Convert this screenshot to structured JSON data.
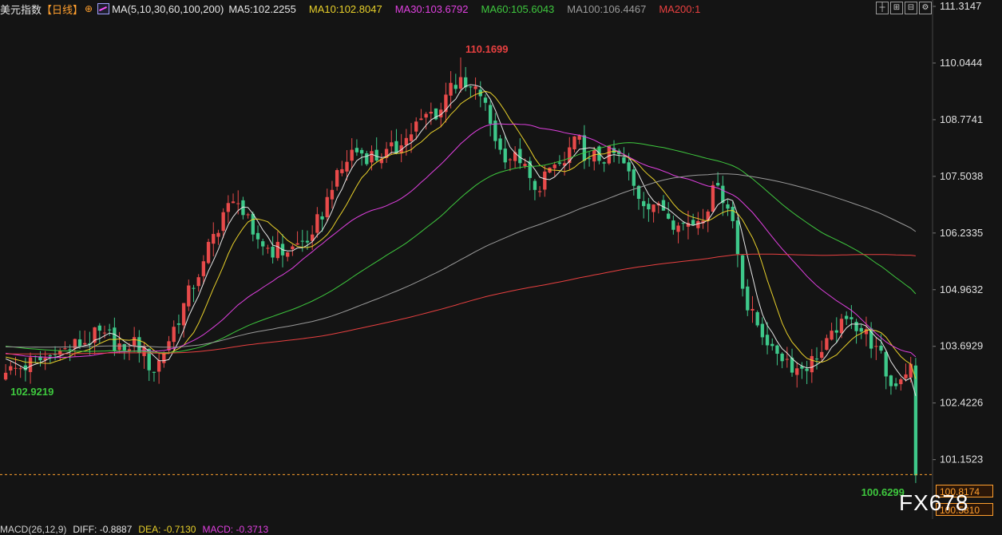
{
  "header": {
    "symbol": "美元指数",
    "period": "【日线】",
    "circle_icon": "⊕",
    "ma_icon": "ma-chart-icon",
    "ma_label": "MA(5,10,30,60,100,200)",
    "ma_values": [
      {
        "text": "MA5:102.2255",
        "color": "#e6e6e6"
      },
      {
        "text": "MA10:102.8047",
        "color": "#e8d02a"
      },
      {
        "text": "MA30:103.6792",
        "color": "#e040e0"
      },
      {
        "text": "MA60:105.6043",
        "color": "#3ec83e"
      },
      {
        "text": "MA100:106.4467",
        "color": "#9a9a9a"
      },
      {
        "text": "MA200:1",
        "color": "#e84040"
      }
    ]
  },
  "tools": [
    "crosshair-icon",
    "zoom-in-icon",
    "zoom-out-icon",
    "settings-icon"
  ],
  "watermark": "FX678",
  "macd": [
    {
      "text": "MACD(26,12,9)",
      "color": "#cfcfcf"
    },
    {
      "text": "DIFF: -0.8887",
      "color": "#e6e6e6"
    },
    {
      "text": "DEA: -0.7130",
      "color": "#e8d02a"
    },
    {
      "text": "MACD: -0.3713",
      "color": "#e040e0"
    }
  ],
  "price_tags": {
    "last": "100.8174",
    "low2": "100.5810"
  },
  "chart_data": {
    "type": "candlestick",
    "title": "美元指数【日线】",
    "ylim": [
      100.0,
      111.3147
    ],
    "y_ticks": [
      "111.3147",
      "110.0444",
      "108.7741",
      "107.5038",
      "106.2335",
      "104.9632",
      "103.6929",
      "102.4226",
      "101.1523"
    ],
    "annotations": [
      {
        "text": "110.1699",
        "candle_index": 92,
        "kind": "high",
        "color": "#e84040"
      },
      {
        "text": "102.9219",
        "candle_index": 0,
        "kind": "low",
        "color": "#3ec83e"
      },
      {
        "text": "100.6299",
        "candle_index": 184,
        "kind": "low",
        "color": "#3ec83e"
      }
    ],
    "last_price": 100.8174,
    "up_color": "#e84a4a",
    "down_color": "#3ec88a",
    "candle_count": 185,
    "anchors": [
      [
        0,
        103.1
      ],
      [
        10,
        103.5
      ],
      [
        20,
        104.0
      ],
      [
        24,
        103.6
      ],
      [
        26,
        103.9
      ],
      [
        30,
        103.1
      ],
      [
        40,
        105.6
      ],
      [
        44,
        106.7
      ],
      [
        47,
        106.9
      ],
      [
        50,
        106.2
      ],
      [
        53,
        105.9
      ],
      [
        57,
        105.8
      ],
      [
        62,
        106.2
      ],
      [
        66,
        107.2
      ],
      [
        70,
        108.1
      ],
      [
        76,
        107.9
      ],
      [
        80,
        108.2
      ],
      [
        84,
        108.8
      ],
      [
        88,
        109.0
      ],
      [
        90,
        109.6
      ],
      [
        93,
        109.5
      ],
      [
        96,
        109.3
      ],
      [
        100,
        108.1
      ],
      [
        104,
        107.8
      ],
      [
        107,
        107.2
      ],
      [
        110,
        107.7
      ],
      [
        113,
        107.8
      ],
      [
        115,
        108.4
      ],
      [
        118,
        107.9
      ],
      [
        124,
        108.0
      ],
      [
        128,
        107.0
      ],
      [
        132,
        106.9
      ],
      [
        136,
        106.4
      ],
      [
        140,
        106.5
      ],
      [
        144,
        107.3
      ],
      [
        147,
        106.5
      ],
      [
        150,
        104.5
      ],
      [
        155,
        103.7
      ],
      [
        160,
        103.2
      ],
      [
        164,
        103.4
      ],
      [
        168,
        104.0
      ],
      [
        171,
        104.3
      ],
      [
        176,
        103.7
      ],
      [
        179,
        102.8
      ],
      [
        183,
        103.3
      ],
      [
        184,
        100.8
      ]
    ],
    "series": [
      {
        "name": "MA5",
        "color": "#e6e6e6",
        "window": 5
      },
      {
        "name": "MA10",
        "color": "#e8d02a",
        "window": 10
      },
      {
        "name": "MA30",
        "color": "#e040e0",
        "window": 30
      },
      {
        "name": "MA60",
        "color": "#3ec83e",
        "window": 60
      },
      {
        "name": "MA100",
        "color": "#9a9a9a",
        "window": 100
      },
      {
        "name": "MA200",
        "color": "#e84040",
        "window": 200
      }
    ],
    "grid": false,
    "legend": "top"
  }
}
